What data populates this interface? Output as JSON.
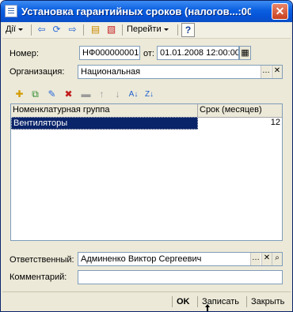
{
  "window": {
    "title": "Установка гарантийных сроков (налогов...:00"
  },
  "toolbar": {
    "actions_label": "Дії",
    "goto_label": "Перейти",
    "help_label": "?"
  },
  "form": {
    "number_label": "Номер:",
    "number_value": "НФ000000001",
    "date_label": "от:",
    "date_value": "01.01.2008 12:00:00",
    "org_label": "Организация:",
    "org_value": "Национальная",
    "responsible_label": "Ответственный:",
    "responsible_value": "Админенко Виктор Сергеевич",
    "comment_label": "Комментарий:",
    "comment_value": ""
  },
  "table": {
    "columns": [
      "Номенклатурная группа",
      "Срок (месяцев)"
    ],
    "rows": [
      {
        "group": "Вентиляторы",
        "term": "12"
      }
    ]
  },
  "footer": {
    "ok_label": "OK",
    "save_label": "Записать",
    "close_label": "Закрыть"
  }
}
